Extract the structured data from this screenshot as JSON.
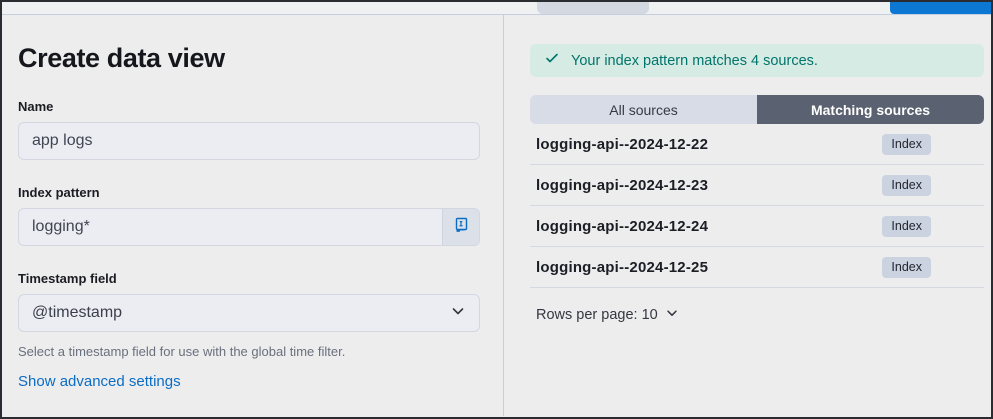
{
  "top_bar": {
    "gray_button_partial": "",
    "blue_button_partial": ""
  },
  "left_panel": {
    "title": "Create data view",
    "fields": {
      "name": {
        "label": "Name",
        "value": "app logs"
      },
      "index_pattern": {
        "label": "Index pattern",
        "value": "logging*",
        "append_icon": "docs-book-icon"
      },
      "timestamp": {
        "label": "Timestamp field",
        "value": "@timestamp",
        "help": "Select a timestamp field for use with the global time filter."
      }
    },
    "advanced_link": "Show advanced settings"
  },
  "right_panel": {
    "callout": {
      "icon": "check-icon",
      "text": "Your index pattern matches 4 sources."
    },
    "tabs": [
      {
        "label": "All sources",
        "selected": false
      },
      {
        "label": "Matching sources",
        "selected": true
      }
    ],
    "sources": [
      {
        "name": "logging-api--2024-12-22",
        "badge": "Index"
      },
      {
        "name": "logging-api--2024-12-23",
        "badge": "Index"
      },
      {
        "name": "logging-api--2024-12-24",
        "badge": "Index"
      },
      {
        "name": "logging-api--2024-12-25",
        "badge": "Index"
      }
    ],
    "rows_per_page": "Rows per page: 10"
  },
  "colors": {
    "accent_blue": "#0c78d3",
    "link_blue": "#0b6cc4",
    "success_bg": "#d7ebe5",
    "success_text": "#00756b",
    "selected_tab_bg": "#5a6170",
    "badge_bg": "#cbd2e0",
    "page_bg": "#ededee",
    "frame_border": "#2b2c31"
  }
}
